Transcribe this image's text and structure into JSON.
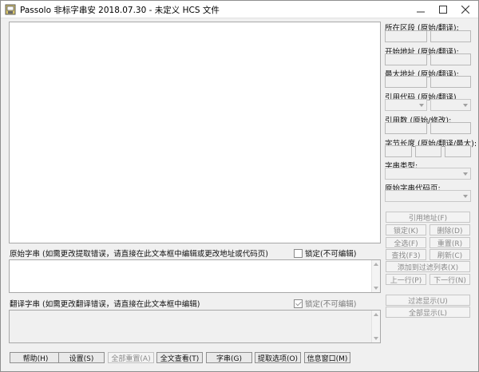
{
  "window": {
    "title": "Passolo 非标字串安 2018.07.30 - 未定义 HCS 文件",
    "min_icon": "minimize-icon",
    "max_icon": "maximize-icon",
    "close_icon": "close-icon"
  },
  "source": {
    "label": "原始字串 (如需更改提取错误，请直接在此文本框中编辑或更改地址或代码页)",
    "lock_label": "锁定(不可编辑)",
    "lock_checked": false
  },
  "translation": {
    "label": "翻译字串 (如需更改翻译错误，请直接在此文本框中编辑)",
    "lock_label": "锁定(不可编辑)",
    "lock_checked": true
  },
  "right_panel": {
    "section_label": "所在区段 (原始/翻译):",
    "start_addr_label": "开始地址 (原始/翻译):",
    "max_addr_label": "最大地址 (原始/翻译):",
    "ref_code_label": "引用代码 (原始/翻译)",
    "ref_count_label": "引用数 (原始/修改):",
    "byte_len_label": "字节长度 (原始/翻译/最大):",
    "string_type_label": "字串类型:",
    "orig_codepage_label": "原始字串代码页:",
    "buttons": {
      "ref_addr": "引用地址(F)",
      "lock": "锁定(K)",
      "delete": "删除(D)",
      "select_all": "全选(F)",
      "reset": "重置(R)",
      "find": "查找(F3)",
      "refresh": "刷新(C)",
      "add_filter": "添加到过滤列表(X)",
      "prev_row": "上一行(P)",
      "next_row": "下一行(N)",
      "filter_show": "过滤显示(U)",
      "show_all": "全部显示(L)"
    }
  },
  "bottom_buttons": {
    "help": "帮助(H)",
    "settings": "设置(S)",
    "reset_all": "全部重置(A)",
    "full_text_view": "全文查看(T)",
    "strings": "字串(G)",
    "extract_options": "提取选项(O)",
    "info_window": "信息窗口(M)"
  },
  "colors": {
    "window_bg": "#f0f0f0",
    "border": "#a8a8a8",
    "disabled_text": "#8a8a8a"
  }
}
